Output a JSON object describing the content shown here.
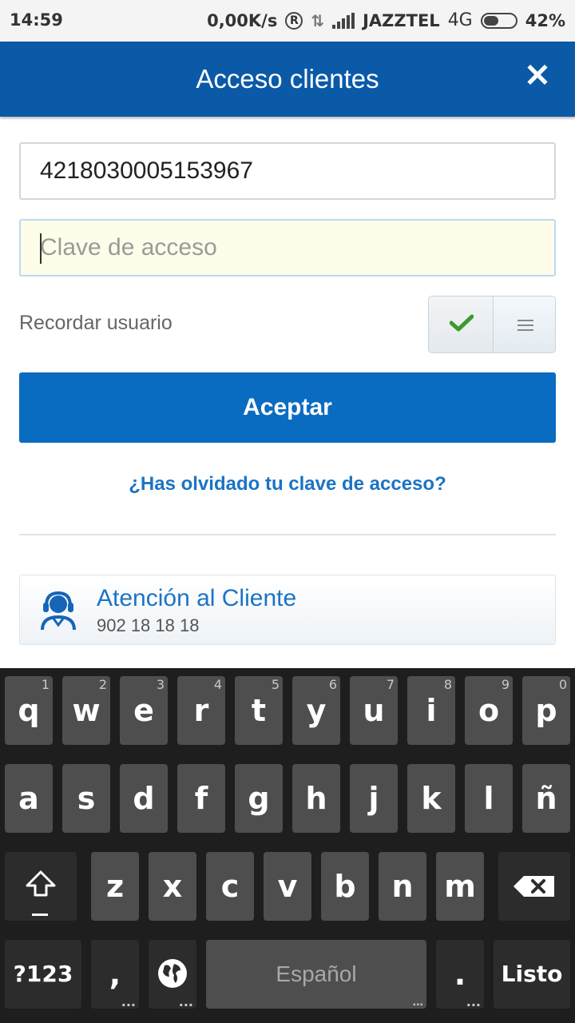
{
  "status_bar": {
    "time": "14:59",
    "speed": "0,00K/s",
    "registered": "R",
    "carrier": "JAZZTEL",
    "network": "4G",
    "battery": "42%"
  },
  "header": {
    "title": "Acceso clientes",
    "close_icon": "close-icon"
  },
  "form": {
    "user_value": "4218030005153967",
    "password_placeholder": "Clave de acceso",
    "remember_label": "Recordar usuario",
    "remember_enabled": true,
    "accept_label": "Aceptar",
    "forgot_link": "¿Has olvidado tu clave de acceso?"
  },
  "support": {
    "title": "Atención al Cliente",
    "phone": "902 18 18 18",
    "icon": "headset-agent-icon"
  },
  "keyboard": {
    "row1": [
      {
        "key": "q",
        "hint": "1"
      },
      {
        "key": "w",
        "hint": "2"
      },
      {
        "key": "e",
        "hint": "3"
      },
      {
        "key": "r",
        "hint": "4"
      },
      {
        "key": "t",
        "hint": "5"
      },
      {
        "key": "y",
        "hint": "6"
      },
      {
        "key": "u",
        "hint": "7"
      },
      {
        "key": "i",
        "hint": "8"
      },
      {
        "key": "o",
        "hint": "9"
      },
      {
        "key": "p",
        "hint": "0"
      }
    ],
    "row2": [
      "a",
      "s",
      "d",
      "f",
      "g",
      "h",
      "j",
      "k",
      "l",
      "ñ"
    ],
    "row3": [
      "z",
      "x",
      "c",
      "v",
      "b",
      "n",
      "m"
    ],
    "symbols_label": "?123",
    "comma": ",",
    "space_label": "Español",
    "period": ".",
    "done_label": "Listo",
    "more": "..."
  },
  "colors": {
    "header": "#0a5aa8",
    "button": "#0a6cc1",
    "link": "#1b74c4",
    "check": "#3c9a2e"
  }
}
